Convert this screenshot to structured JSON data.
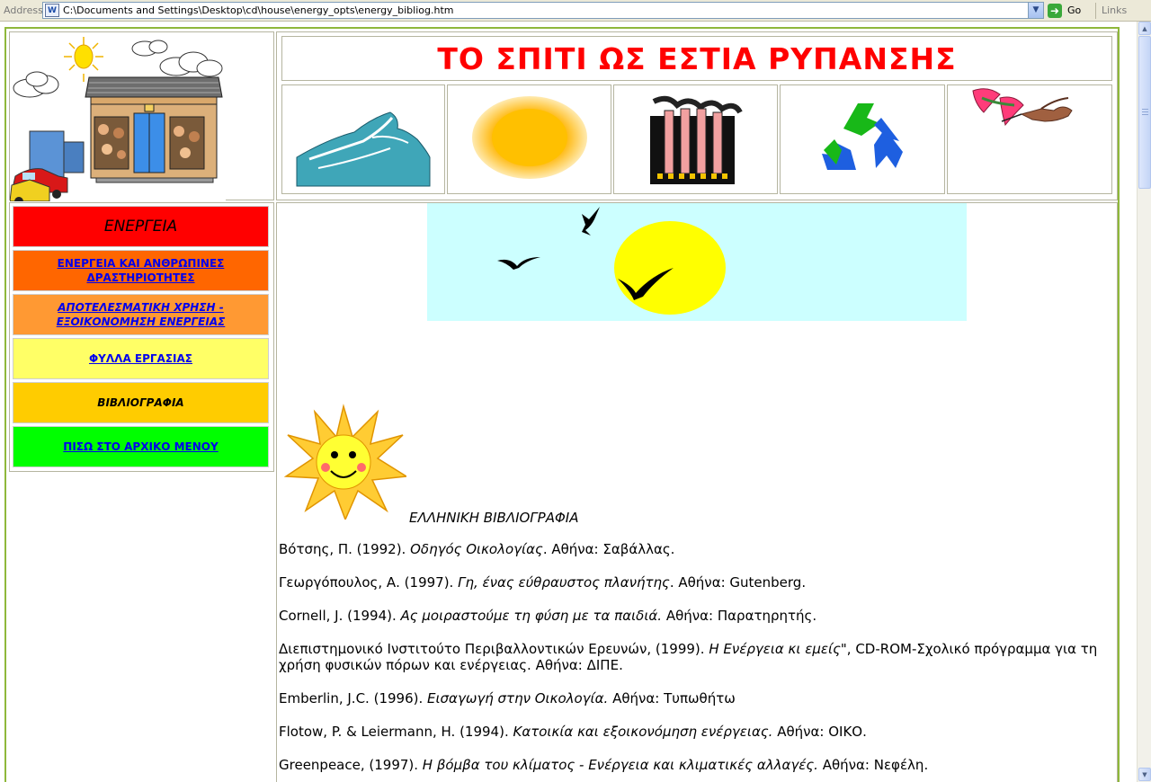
{
  "browser": {
    "address_label": "Address",
    "url": "C:\\Documents and Settings\\Desktop\\cd\\house\\energy_opts\\energy_bibliog.htm",
    "go_label": "Go",
    "links_label": "Links"
  },
  "header": {
    "title": "ΤΟ ΣΠΙΤΙ ΩΣ ΕΣΤΙΑ ΡΥΠΑΝΣΗΣ",
    "title_color": "#ff0000",
    "icons": [
      "wave-icon",
      "sun-icon",
      "factory-icon",
      "recycle-icon",
      "hummingbird-icon"
    ]
  },
  "nav": {
    "title": "ΕΝΕΡΓΕΙΑ",
    "items": [
      {
        "label_line1": "ΕΝΕΡΓΕΙΑ ΚΑΙ ΑΝΘΡΩΠΙΝΕΣ",
        "label_line2": "ΔΡΑΣΤΗΡΙΟΤΗΤΕΣ",
        "color": "#ff6600"
      },
      {
        "label_line1": "ΑΠΟΤΕΛΕΣΜΑΤΙΚΗ ΧΡΗΣΗ -",
        "label_line2": "ΕΞΟΙΚΟΝΟΜΗΣΗ ΕΝΕΡΓΕΙΑΣ",
        "color": "#ff9933"
      },
      {
        "label": "ΦΥΛΛΑ ΕΡΓΑΣΙΑΣ",
        "color": "#ffff66"
      },
      {
        "label": "ΒΙΒΛΙΟΓΡΑΦΙΑ",
        "color": "#ffcc00"
      },
      {
        "label": "ΠΙΣΩ ΣΤΟ ΑΡΧΙΚΟ ΜΕΝΟΥ",
        "color": "#00ff00"
      }
    ],
    "title_color": "#ff0000"
  },
  "content": {
    "heading": "ΕΛΛΗΝΙΚΗ ΒΙΒΛΙΟΓΡΑΦΙΑ",
    "bibliography": [
      {
        "pre": "Βότσης, Π. (1992). ",
        "title": "Οδηγός Οικολογίας",
        "post": ". Αθήνα: Σαβάλλας."
      },
      {
        "pre": "Γεωργόπουλος, Α. (1997). ",
        "title": "Γη, ένας εύθραυστος πλανήτης",
        "post": ". Αθήνα: Gutenberg."
      },
      {
        "pre": "Cornell, J. (1994). ",
        "title": "Ας μοιραστούμε τη φύση με τα παιδιά.",
        "post": " Αθήνα: Παρατηρητής."
      },
      {
        "pre": "Διεπιστημονικό Ινστιτούτο Περιβαλλοντικών Ερευνών, (1999). ",
        "title": "Η Ενέργεια κι εμείς\"",
        "post": ", CD-ROM-Σχολικό πρόγραμμα για τη χρήση φυσικών πόρων και ενέργειας. Αθήνα: ΔΙΠΕ."
      },
      {
        "pre": "Emberlin, J.C. (1996). ",
        "title": "Εισαγωγή στην Οικολογία.",
        "post": " Αθήνα: Τυπωθήτω"
      },
      {
        "pre": "Flotow, P. & Leiermann, H. (1994). ",
        "title": "Κατοικία και εξοικονόμηση ενέργειας.",
        "post": " Αθήνα: ΟΙΚΟ."
      },
      {
        "pre": "Greenpeace, (1997). ",
        "title": "Η βόμβα του κλίματος - Ενέργεια και κλιματικές αλλαγές.",
        "post": " Αθήνα: Νεφέλη."
      }
    ]
  }
}
